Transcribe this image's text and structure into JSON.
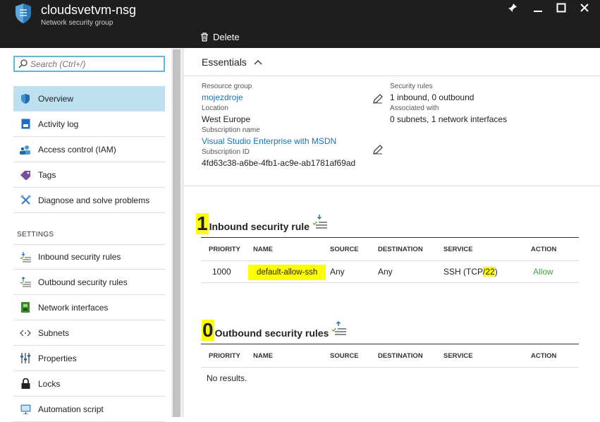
{
  "window": {
    "title": "cloudsvetvm-nsg",
    "subtitle": "Network security group",
    "controls": [
      "pin-icon",
      "minimize-icon",
      "maximize-icon",
      "close-icon"
    ]
  },
  "toolbar": {
    "delete_label": "Delete"
  },
  "search": {
    "placeholder": "Search (Ctrl+/)"
  },
  "sidebar": {
    "items": [
      {
        "label": "Overview",
        "icon": "shield-icon",
        "active": true
      },
      {
        "label": "Activity log",
        "icon": "activity-log-icon"
      },
      {
        "label": "Access control (IAM)",
        "icon": "users-icon"
      },
      {
        "label": "Tags",
        "icon": "tag-icon"
      },
      {
        "label": "Diagnose and solve problems",
        "icon": "wrench-icon"
      }
    ],
    "settings_header": "SETTINGS",
    "settings_items": [
      {
        "label": "Inbound security rules",
        "icon": "inbound-rules-icon"
      },
      {
        "label": "Outbound security rules",
        "icon": "outbound-rules-icon"
      },
      {
        "label": "Network interfaces",
        "icon": "nic-icon"
      },
      {
        "label": "Subnets",
        "icon": "subnet-icon"
      },
      {
        "label": "Properties",
        "icon": "properties-icon"
      },
      {
        "label": "Locks",
        "icon": "lock-icon"
      },
      {
        "label": "Automation script",
        "icon": "automation-icon"
      }
    ]
  },
  "essentials": {
    "header": "Essentials",
    "resource_group_label": "Resource group",
    "resource_group": "mojezdroje",
    "location_label": "Location",
    "location": "West Europe",
    "subscription_name_label": "Subscription name",
    "subscription_name": "Visual Studio Enterprise with MSDN",
    "subscription_id_label": "Subscription ID",
    "subscription_id": "4fd63c38-a6be-4fb1-ac9e-ab1781af69ad",
    "security_rules_label": "Security rules",
    "security_rules": "1 inbound, 0 outbound",
    "associated_label": "Associated with",
    "associated": "0 subnets, 1 network interfaces"
  },
  "inbound": {
    "count": "1",
    "title": "Inbound security rule",
    "columns": [
      "PRIORITY",
      "NAME",
      "SOURCE",
      "DESTINATION",
      "SERVICE",
      "ACTION"
    ],
    "rows": [
      {
        "priority": "1000",
        "name": "default-allow-ssh",
        "source": "Any",
        "destination": "Any",
        "service_prefix": "SSH (TCP",
        "service_port": "/22",
        "service_suffix": ")",
        "action": "Allow"
      }
    ]
  },
  "outbound": {
    "count": "0",
    "title": "Outbound security rules",
    "columns": [
      "PRIORITY",
      "NAME",
      "SOURCE",
      "DESTINATION",
      "SERVICE",
      "ACTION"
    ],
    "empty": "No results."
  },
  "colors": {
    "accent": "#1a73b5",
    "active_nav": "#bce0f0",
    "topbar": "#1e1e1e",
    "highlight": "#ffff00",
    "allow": "#3aa935"
  }
}
